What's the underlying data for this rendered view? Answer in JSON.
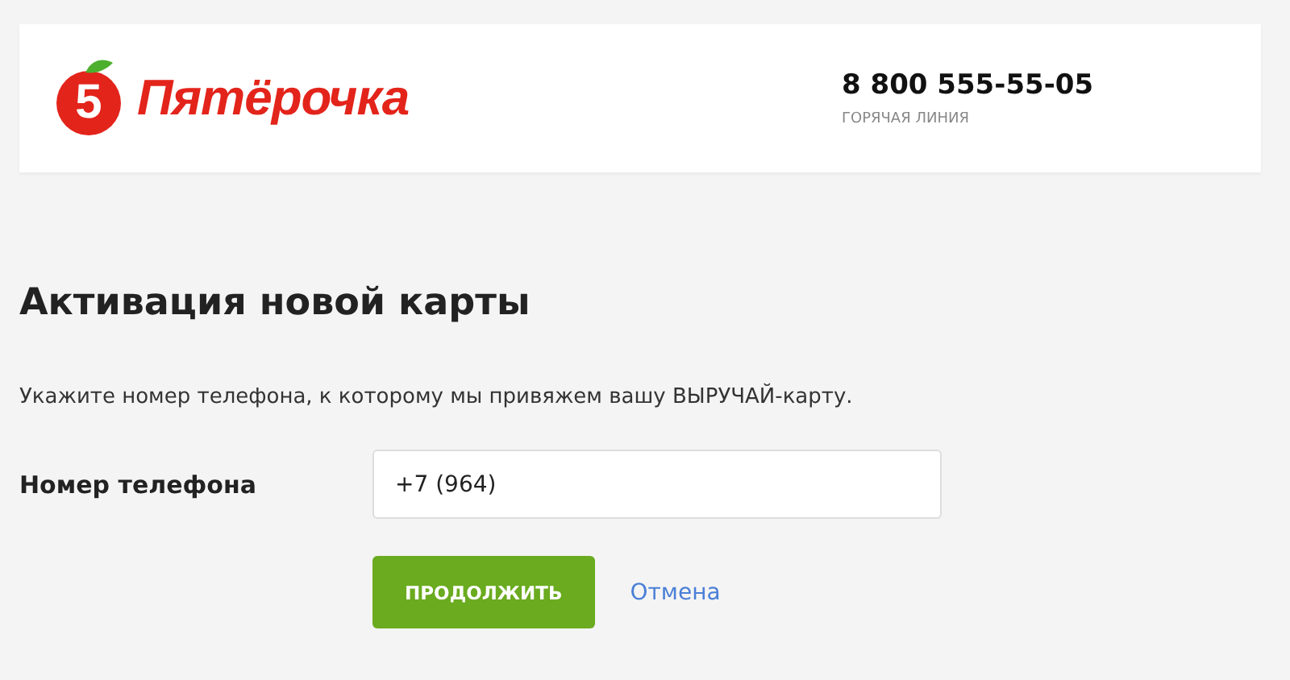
{
  "header": {
    "logo_mark": "5",
    "logo_text": "Пятёрочка",
    "hotline_phone": "8 800 555-55-05",
    "hotline_label": "ГОРЯЧАЯ ЛИНИЯ"
  },
  "title": "Активация новой карты",
  "instruction": "Укажите номер телефона, к которому мы привяжем вашу ВЫРУЧАЙ-карту.",
  "phone_field": {
    "label": "Номер телефона",
    "value": "+7 (964)"
  },
  "buttons": [
    {
      "kind": "primary",
      "label": "ПРОДОЛЖИТЬ"
    },
    {
      "kind": "link",
      "label": "Отмена"
    }
  ]
}
